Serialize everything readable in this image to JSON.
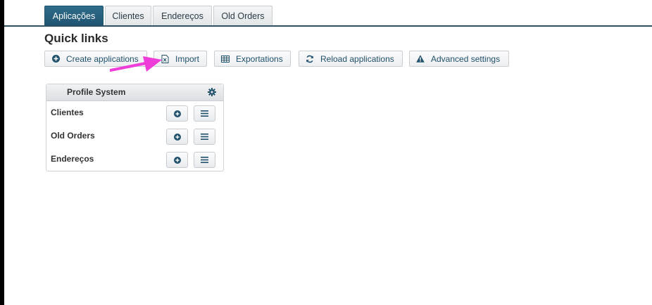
{
  "tabs": [
    {
      "label": "Aplicações",
      "active": true
    },
    {
      "label": "Clientes",
      "active": false
    },
    {
      "label": "Endereços",
      "active": false
    },
    {
      "label": "Old Orders",
      "active": false
    }
  ],
  "quick_links": {
    "title": "Quick links",
    "buttons": [
      {
        "label": "Create applications",
        "icon": "plus-circle-icon"
      },
      {
        "label": "Import",
        "icon": "excel-file-icon"
      },
      {
        "label": "Exportations",
        "icon": "table-icon"
      },
      {
        "label": "Reload applications",
        "icon": "refresh-icon"
      },
      {
        "label": "Advanced settings",
        "icon": "warning-icon"
      }
    ]
  },
  "panel": {
    "title": "Profile System",
    "rows": [
      {
        "label": "Clientes"
      },
      {
        "label": "Old Orders"
      },
      {
        "label": "Endereços"
      }
    ]
  },
  "colors": {
    "accent": "#1f5470",
    "link_text": "#21516b",
    "annotation_arrow": "#ee3dd9"
  }
}
